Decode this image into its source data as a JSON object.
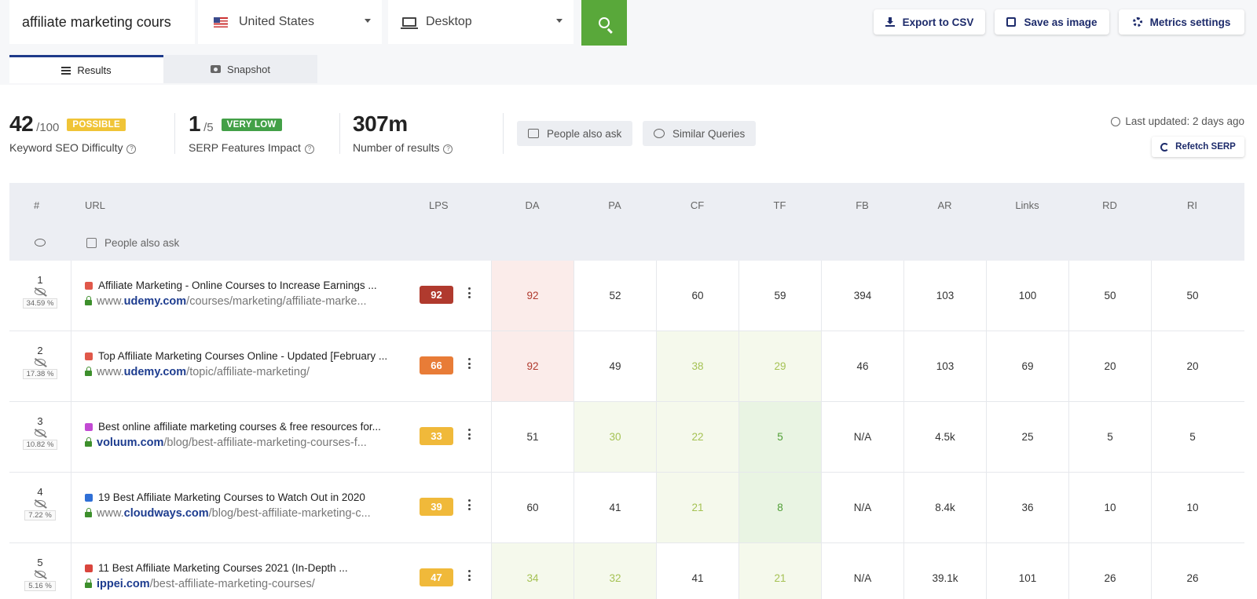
{
  "search": {
    "query": "affiliate marketing cours"
  },
  "country": {
    "value": "United States"
  },
  "device": {
    "value": "Desktop"
  },
  "toolbar": {
    "export_label": "Export to CSV",
    "save_image_label": "Save as image",
    "metrics_label": "Metrics settings"
  },
  "tabs": [
    {
      "label": "Results",
      "active": true
    },
    {
      "label": "Snapshot",
      "active": false
    }
  ],
  "stats": {
    "difficulty": {
      "value": "42",
      "max": "/100",
      "badge": "POSSIBLE",
      "badge_color": "#f0c437",
      "label": "Keyword SEO Difficulty"
    },
    "serp": {
      "value": "1",
      "max": "/5",
      "badge": "VERY LOW",
      "badge_color": "#43a047",
      "label": "SERP Features Impact"
    },
    "results": {
      "value": "307m",
      "label": "Number of results"
    }
  },
  "chips": {
    "people_also_ask": "People also ask",
    "similar_queries": "Similar Queries"
  },
  "last_updated": "Last updated: 2 days ago",
  "refetch_label": "Refetch SERP",
  "table": {
    "headers": {
      "rank": "#",
      "url": "URL",
      "lps": "LPS",
      "metrics": [
        "DA",
        "PA",
        "CF",
        "TF",
        "FB",
        "AR",
        "Links",
        "RD",
        "RI"
      ]
    },
    "subrow_label": "People also ask",
    "rows": [
      {
        "rank": "1",
        "share": "34.59 %",
        "title": "Affiliate Marketing - Online Courses to Increase Earnings ...",
        "url_prefix": "www.",
        "domain": "udemy.com",
        "path": "/courses/marketing/affiliate-marke...",
        "lps": "92",
        "lps_color": "#b03a2e",
        "fav_color": "#e0584a",
        "metrics": [
          "92",
          "52",
          "60",
          "59",
          "394",
          "103",
          "100",
          "50",
          "50"
        ],
        "bg": [
          "#fbecea",
          "",
          "",
          "",
          "",
          "",
          "",
          "",
          ""
        ],
        "fg": [
          "#b03a2e",
          "",
          "",
          "",
          "",
          "",
          "",
          "",
          ""
        ]
      },
      {
        "rank": "2",
        "share": "17.38 %",
        "title": "Top Affiliate Marketing Courses Online - Updated [February ...",
        "url_prefix": "www.",
        "domain": "udemy.com",
        "path": "/topic/affiliate-marketing/",
        "lps": "66",
        "lps_color": "#e87c37",
        "fav_color": "#e0584a",
        "metrics": [
          "92",
          "49",
          "38",
          "29",
          "46",
          "103",
          "69",
          "20",
          "20"
        ],
        "bg": [
          "#fbecea",
          "",
          "#f5f9ec",
          "#f5f9ec",
          "",
          "",
          "",
          "",
          ""
        ],
        "fg": [
          "#b03a2e",
          "",
          "#a5c254",
          "#a5c254",
          "",
          "",
          "",
          "",
          ""
        ]
      },
      {
        "rank": "3",
        "share": "10.82 %",
        "title": "Best online affiliate marketing courses & free resources for...",
        "url_prefix": "",
        "domain": "voluum.com",
        "path": "/blog/best-affiliate-marketing-courses-f...",
        "lps": "33",
        "lps_color": "#f0b93a",
        "fav_color": "#c24ad3",
        "metrics": [
          "51",
          "30",
          "22",
          "5",
          "N/A",
          "4.5k",
          "25",
          "5",
          "5"
        ],
        "bg": [
          "",
          "#f5f9ec",
          "#f5f9ec",
          "#e9f4e3",
          "",
          "",
          "",
          "",
          ""
        ],
        "fg": [
          "",
          "#a5c254",
          "#a5c254",
          "#4f9e35",
          "",
          "",
          "",
          "",
          ""
        ]
      },
      {
        "rank": "4",
        "share": "7.22 %",
        "title": "19 Best Affiliate Marketing Courses to Watch Out in 2020",
        "url_prefix": "www.",
        "domain": "cloudways.com",
        "path": "/blog/best-affiliate-marketing-c...",
        "lps": "39",
        "lps_color": "#f0b93a",
        "fav_color": "#2f6fd6",
        "metrics": [
          "60",
          "41",
          "21",
          "8",
          "N/A",
          "8.4k",
          "36",
          "10",
          "10"
        ],
        "bg": [
          "",
          "",
          "#f5f9ec",
          "#e9f4e3",
          "",
          "",
          "",
          "",
          ""
        ],
        "fg": [
          "",
          "",
          "#a5c254",
          "#4f9e35",
          "",
          "",
          "",
          "",
          ""
        ]
      },
      {
        "rank": "5",
        "share": "5.16 %",
        "title": "11 Best Affiliate Marketing Courses 2021 (In-Depth ...",
        "url_prefix": "",
        "domain": "ippei.com",
        "path": "/best-affiliate-marketing-courses/",
        "lps": "47",
        "lps_color": "#f0b93a",
        "fav_color": "#d9453d",
        "metrics": [
          "34",
          "32",
          "41",
          "21",
          "N/A",
          "39.1k",
          "101",
          "26",
          "26"
        ],
        "bg": [
          "#f5f9ec",
          "#f5f9ec",
          "",
          "#f5f9ec",
          "",
          "",
          "",
          "",
          ""
        ],
        "fg": [
          "#a5c254",
          "#a5c254",
          "",
          "#a5c254",
          "",
          "",
          "",
          "",
          ""
        ]
      }
    ]
  }
}
